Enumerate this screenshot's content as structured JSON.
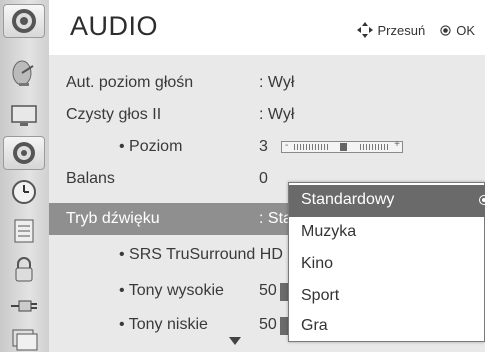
{
  "header": {
    "title": "AUDIO",
    "move_hint": "Przesuń",
    "ok_hint": "OK"
  },
  "sidebar": {
    "items": [
      {
        "icon": "speaker-icon"
      },
      {
        "icon": "satellite-dish-icon"
      },
      {
        "icon": "monitor-icon"
      },
      {
        "icon": "speaker-icon",
        "active": true
      },
      {
        "icon": "clock-icon"
      },
      {
        "icon": "option-list-icon"
      },
      {
        "icon": "lock-icon"
      },
      {
        "icon": "input-plug-icon"
      },
      {
        "icon": "photo-media-icon"
      }
    ]
  },
  "menu": {
    "rows": [
      {
        "label": "Aut. poziom głośn",
        "value": ": Wył"
      },
      {
        "label": "Czysty głos II",
        "value": ": Wył"
      },
      {
        "label": "• Poziom",
        "value": "3"
      },
      {
        "label": "Balans",
        "value": "0"
      },
      {
        "label": "Tryb dźwięku",
        "value": ": Sta"
      },
      {
        "label": "• SRS TruSurround HD :",
        "value": ""
      },
      {
        "label": "• Tony wysokie",
        "value": "50"
      },
      {
        "label": "• Tony niskie",
        "value": "50"
      }
    ],
    "slider": {
      "minus": "-",
      "plus": "+",
      "level": 3
    }
  },
  "dropdown": {
    "options": [
      {
        "label": "Standardowy",
        "selected": true
      },
      {
        "label": "Muzyka"
      },
      {
        "label": "Kino"
      },
      {
        "label": "Sport"
      },
      {
        "label": "Gra"
      }
    ]
  },
  "colors": {
    "selected_row": "#8f8f8f",
    "highlight_option": "#6a6a6a",
    "menu_background": "#e9e9e9"
  }
}
